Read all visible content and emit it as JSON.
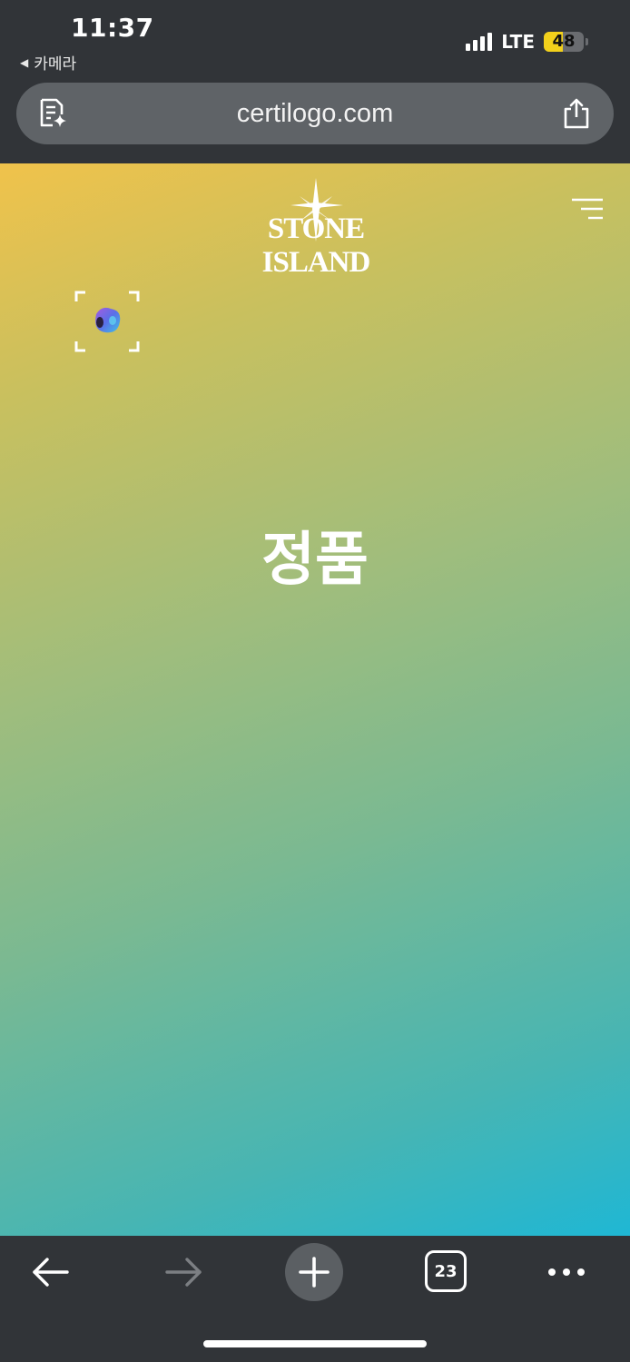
{
  "status_bar": {
    "time": "11:37",
    "back_app": "카메라",
    "network": "LTE",
    "battery": "48",
    "battery_level": 0.48
  },
  "address_bar": {
    "url": "certilogo.com",
    "left_icon": "reader-summary-icon",
    "right_icon": "share-icon"
  },
  "page": {
    "brand": "STONE ISLAND",
    "verdict": "정품",
    "menu_icon": "hamburger-menu-icon",
    "scan_icon": "scan-frame-icon",
    "colors": {
      "gradient_top": "#f0c24b",
      "gradient_mid": "#9fbd7d",
      "gradient_bottom": "#1fb7d4"
    }
  },
  "toolbar": {
    "tab_count": "23",
    "icons": [
      "back-arrow-icon",
      "forward-arrow-icon",
      "plus-icon",
      "tabs-icon",
      "more-icon"
    ]
  }
}
